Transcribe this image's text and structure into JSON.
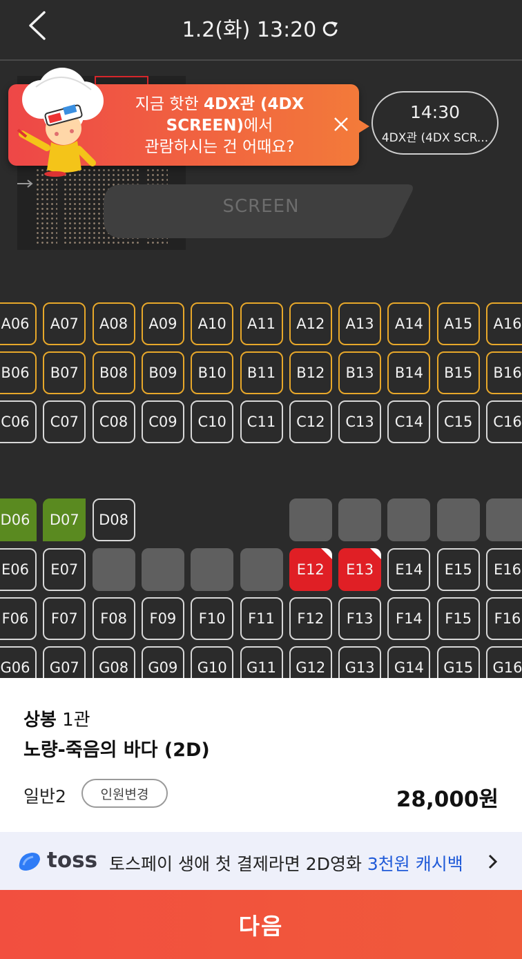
{
  "header": {
    "title": "1.2(화) 13:20"
  },
  "promo": {
    "line1_plain": "지금 핫한 ",
    "line1_bold": "4DX관 (4DX",
    "line2_bold": "SCREEN)",
    "line2_plain": "에서",
    "line3": "관람하시는 건 어때요?"
  },
  "time_option": {
    "time": "14:30",
    "hall": "4DX관 (4DX SCR..."
  },
  "screen_label": "SCREEN",
  "seats": [
    {
      "row": "A",
      "labels": [
        "A06",
        "A07",
        "A08",
        "A09",
        "A10",
        "A11",
        "A12",
        "A13",
        "A14",
        "A15",
        "A16"
      ],
      "states": [
        "premium",
        "premium",
        "premium",
        "premium",
        "premium",
        "premium",
        "premium",
        "premium",
        "premium",
        "premium",
        "premium"
      ]
    },
    {
      "row": "B",
      "labels": [
        "B06",
        "B07",
        "B08",
        "B09",
        "B10",
        "B11",
        "B12",
        "B13",
        "B14",
        "B15",
        "B16"
      ],
      "states": [
        "premium",
        "premium",
        "premium",
        "premium",
        "premium",
        "premium",
        "premium",
        "premium",
        "premium",
        "premium",
        "premium"
      ]
    },
    {
      "row": "C",
      "labels": [
        "C06",
        "C07",
        "C08",
        "C09",
        "C10",
        "C11",
        "C12",
        "C13",
        "C14",
        "C15",
        "C16"
      ],
      "states": [
        "normal",
        "normal",
        "normal",
        "normal",
        "normal",
        "normal",
        "normal",
        "normal",
        "normal",
        "normal",
        "normal"
      ]
    },
    {
      "row": "D",
      "labels": [
        "D06",
        "D07",
        "D08",
        "",
        "",
        "",
        "",
        "",
        "",
        "",
        ""
      ],
      "states": [
        "couple-left",
        "couple-right",
        "normal",
        "none",
        "none",
        "none",
        "blocked",
        "blocked",
        "blocked",
        "blocked",
        "blocked"
      ]
    },
    {
      "row": "E",
      "labels": [
        "E06",
        "E07",
        "",
        "",
        "",
        "",
        "E12",
        "E13",
        "E14",
        "E15",
        "E16"
      ],
      "states": [
        "normal",
        "normal",
        "blocked",
        "blocked",
        "blocked",
        "blocked",
        "selected",
        "selected",
        "normal",
        "normal",
        "normal"
      ]
    },
    {
      "row": "F",
      "labels": [
        "F06",
        "F07",
        "F08",
        "F09",
        "F10",
        "F11",
        "F12",
        "F13",
        "F14",
        "F15",
        "F16"
      ],
      "states": [
        "normal",
        "normal",
        "normal",
        "normal",
        "normal",
        "normal",
        "normal",
        "normal",
        "normal",
        "normal",
        "normal"
      ]
    },
    {
      "row": "G",
      "labels": [
        "G06",
        "G07",
        "G08",
        "G09",
        "G10",
        "G11",
        "G12",
        "G13",
        "G14",
        "G15",
        "G16"
      ],
      "states": [
        "normal",
        "normal",
        "normal",
        "normal",
        "normal",
        "normal",
        "normal",
        "normal",
        "normal",
        "normal",
        "normal"
      ]
    }
  ],
  "summary": {
    "theater_name": "상봉",
    "hall": " 1관",
    "movie": "노량-죽음의 바다 (2D)",
    "people": "일반2",
    "change_label": "인원변경",
    "price": "28,000원"
  },
  "toss": {
    "brand": "toss",
    "message": "토스페이 생애 첫 결제라면 2D영화 ",
    "highlight": "3천원 캐시백"
  },
  "next_label": "다음",
  "colors": {
    "accent": "#f24f3f",
    "selected": "#e01f25",
    "premium_border": "#e8a82a",
    "couple": "#5a8a20",
    "toss_blue": "#1f5ad8"
  }
}
